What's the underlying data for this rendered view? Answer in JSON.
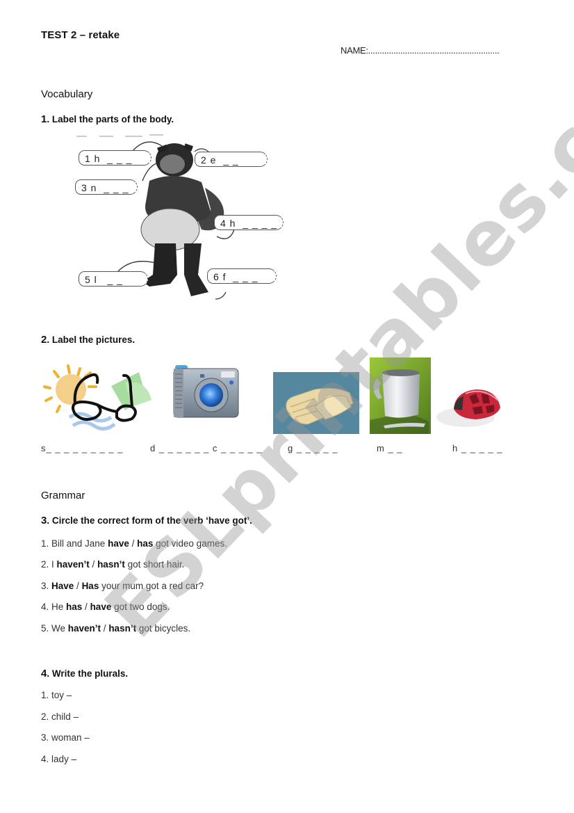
{
  "header": {
    "title": "TEST 2 – retake",
    "name_field": "NAME:........................................................."
  },
  "vocabulary": {
    "heading": "Vocabulary",
    "q1": {
      "number": "1",
      "instruction": ". Label the parts of the body.",
      "labels": [
        {
          "id": "1",
          "text": "1 h  _ _ _"
        },
        {
          "id": "2",
          "text": "2 e  _ _"
        },
        {
          "id": "3",
          "text": "3 n  _ _ _"
        },
        {
          "id": "4",
          "text": "4 h  _ _ _ _"
        },
        {
          "id": "5",
          "text": "5 l   _ _"
        },
        {
          "id": "6",
          "text": "6 f  _ _ _"
        }
      ]
    },
    "q2": {
      "number": "2",
      "instruction": ". Label the pictures.",
      "pictures": [
        {
          "icon": "sunglasses-image",
          "blank": "s_ _ _ _ _ _ _ _ _"
        },
        {
          "icon": "digital-camera-image",
          "blank": "d _ _ _ _ _ _ c _ _ _ _ _"
        },
        {
          "icon": "gloves-image",
          "blank": "g _ _ _ _ _"
        },
        {
          "icon": "mug-image",
          "blank": "m _ _"
        },
        {
          "icon": "helmet-image",
          "blank": "h _ _ _ _ _"
        }
      ]
    }
  },
  "grammar": {
    "heading": "Grammar",
    "q3": {
      "number": "3",
      "instruction": ". Circle the correct form of the verb ‘have got’.",
      "items": [
        {
          "n": "1. ",
          "pre": "Bill and Jane ",
          "opt1": "have",
          "sep": " / ",
          "opt2": "has",
          "post": " got video games."
        },
        {
          "n": "2. ",
          "pre": "I ",
          "opt1": "haven’t",
          "sep": " / ",
          "opt2": "hasn’t",
          "post": " got short hair."
        },
        {
          "n": "3. ",
          "pre": "",
          "opt1": "Have",
          "sep": " / ",
          "opt2": "Has",
          "post": " your mum got a red car?"
        },
        {
          "n": "4. ",
          "pre": "He ",
          "opt1": "has",
          "sep": " / ",
          "opt2": "have",
          "post": " got two dogs."
        },
        {
          "n": "5. ",
          "pre": "We ",
          "opt1": "haven’t",
          "sep": " / ",
          "opt2": "hasn’t",
          "post": " got bicycles."
        }
      ]
    },
    "q4": {
      "number": "4",
      "instruction": ". Write the plurals.",
      "items": [
        "1. toy –",
        "2. child –",
        "3. woman –",
        "4. lady –"
      ]
    }
  },
  "watermark": "ESLprintables.com"
}
